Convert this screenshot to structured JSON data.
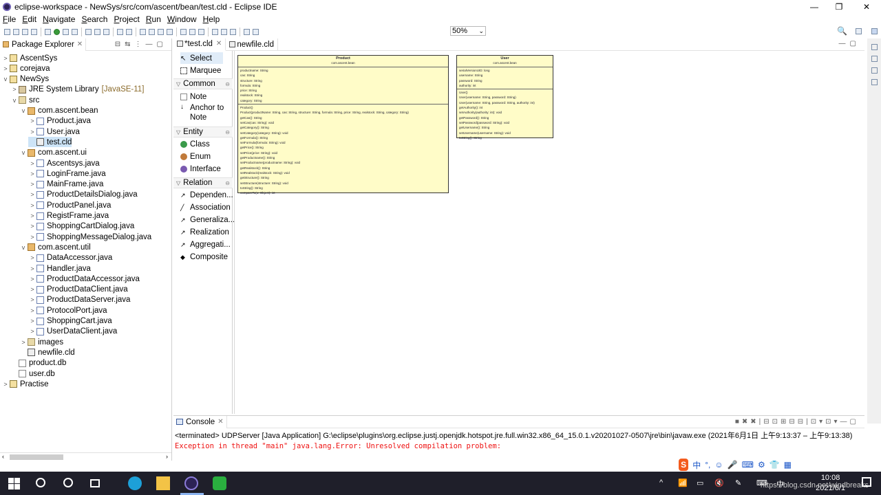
{
  "window": {
    "title": "eclipse-workspace - NewSys/src/com/ascent/bean/test.cld - Eclipse IDE",
    "minimize": "—",
    "maximize": "❐",
    "close": "✕"
  },
  "menu": [
    "File",
    "Edit",
    "Navigate",
    "Search",
    "Project",
    "Run",
    "Window",
    "Help"
  ],
  "toolbar": {
    "zoom": "50%"
  },
  "package_explorer": {
    "title": "Package Explorer",
    "tree": [
      {
        "label": "AscentSys",
        "level": 0,
        "toggle": ">",
        "icon": "project-icon"
      },
      {
        "label": "corejava",
        "level": 0,
        "toggle": ">",
        "icon": "project-icon"
      },
      {
        "label": "NewSys",
        "level": 0,
        "toggle": "v",
        "icon": "project-icon"
      },
      {
        "label": "JRE System Library",
        "extra": "[JavaSE-11]",
        "level": 1,
        "toggle": ">",
        "icon": "library-icon"
      },
      {
        "label": "src",
        "level": 1,
        "toggle": "v",
        "icon": "source-folder-icon"
      },
      {
        "label": "com.ascent.bean",
        "level": 2,
        "toggle": "v",
        "icon": "package-icon"
      },
      {
        "label": "Product.java",
        "level": 3,
        "toggle": ">",
        "icon": "java-file-icon"
      },
      {
        "label": "User.java",
        "level": 3,
        "toggle": ">",
        "icon": "java-file-icon"
      },
      {
        "label": "test.cld",
        "level": 3,
        "toggle": "",
        "icon": "cld-file-icon",
        "selected": true
      },
      {
        "label": "com.ascent.ui",
        "level": 2,
        "toggle": "v",
        "icon": "package-icon"
      },
      {
        "label": "Ascentsys.java",
        "level": 3,
        "toggle": ">",
        "icon": "java-file-icon"
      },
      {
        "label": "LoginFrame.java",
        "level": 3,
        "toggle": ">",
        "icon": "java-file-icon"
      },
      {
        "label": "MainFrame.java",
        "level": 3,
        "toggle": ">",
        "icon": "java-file-icon"
      },
      {
        "label": "ProductDetailsDialog.java",
        "level": 3,
        "toggle": ">",
        "icon": "java-file-icon"
      },
      {
        "label": "ProductPanel.java",
        "level": 3,
        "toggle": ">",
        "icon": "java-file-icon"
      },
      {
        "label": "RegistFrame.java",
        "level": 3,
        "toggle": ">",
        "icon": "java-file-icon"
      },
      {
        "label": "ShoppingCartDialog.java",
        "level": 3,
        "toggle": ">",
        "icon": "java-file-icon"
      },
      {
        "label": "ShoppingMessageDialog.java",
        "level": 3,
        "toggle": ">",
        "icon": "java-file-icon"
      },
      {
        "label": "com.ascent.util",
        "level": 2,
        "toggle": "v",
        "icon": "package-icon"
      },
      {
        "label": "DataAccessor.java",
        "level": 3,
        "toggle": ">",
        "icon": "java-file-icon"
      },
      {
        "label": "Handler.java",
        "level": 3,
        "toggle": ">",
        "icon": "java-file-icon"
      },
      {
        "label": "ProductDataAccessor.java",
        "level": 3,
        "toggle": ">",
        "icon": "java-file-icon"
      },
      {
        "label": "ProductDataClient.java",
        "level": 3,
        "toggle": ">",
        "icon": "java-file-icon"
      },
      {
        "label": "ProductDataServer.java",
        "level": 3,
        "toggle": ">",
        "icon": "java-file-icon"
      },
      {
        "label": "ProtocolPort.java",
        "level": 3,
        "toggle": ">",
        "icon": "java-file-icon"
      },
      {
        "label": "ShoppingCart.java",
        "level": 3,
        "toggle": ">",
        "icon": "java-file-icon"
      },
      {
        "label": "UserDataClient.java",
        "level": 3,
        "toggle": ">",
        "icon": "java-file-icon"
      },
      {
        "label": "images",
        "level": 2,
        "toggle": ">",
        "icon": "folder-icon"
      },
      {
        "label": "newfile.cld",
        "level": 2,
        "toggle": "",
        "icon": "cld-file-icon"
      },
      {
        "label": "product.db",
        "level": 1,
        "toggle": "",
        "icon": "file-icon"
      },
      {
        "label": "user.db",
        "level": 1,
        "toggle": "",
        "icon": "file-icon"
      },
      {
        "label": "Practise",
        "level": 0,
        "toggle": ">",
        "icon": "project-icon"
      }
    ]
  },
  "editor": {
    "tabs": [
      {
        "label": "*test.cld",
        "active": true
      },
      {
        "label": "newfile.cld",
        "active": false
      }
    ]
  },
  "palette": {
    "tools": [
      {
        "label": "Select",
        "icon": "select-arrow-icon",
        "selected": true
      },
      {
        "label": "Marquee",
        "icon": "marquee-icon"
      }
    ],
    "drawers": [
      {
        "label": "Common",
        "items": [
          {
            "label": "Note",
            "icon": "note-icon"
          },
          {
            "label": "Anchor to Note",
            "icon": "anchor-icon"
          }
        ]
      },
      {
        "label": "Entity",
        "items": [
          {
            "label": "Class",
            "icon": "class-icon"
          },
          {
            "label": "Enum",
            "icon": "enum-icon"
          },
          {
            "label": "Interface",
            "icon": "interface-icon"
          }
        ]
      },
      {
        "label": "Relation",
        "items": [
          {
            "label": "Dependen...",
            "icon": "dependency-icon"
          },
          {
            "label": "Association",
            "icon": "association-icon"
          },
          {
            "label": "Generaliza...",
            "icon": "generalization-icon"
          },
          {
            "label": "Realization",
            "icon": "realization-icon"
          },
          {
            "label": "Aggregati...",
            "icon": "aggregation-icon"
          },
          {
            "label": "Composite",
            "icon": "composite-icon"
          }
        ]
      }
    ]
  },
  "diagram": {
    "product": {
      "name": "Product",
      "package": "com.ascent.bean",
      "fields": [
        "productname: String",
        "cas: String",
        "structure: String",
        "formula: String",
        "price: String",
        "realstock: String",
        "category: String"
      ],
      "methods": [
        "Product()",
        "Product(productName: String, cas: String, structure: String, formula: String, price: String, realstock: String, category: String)",
        "getCas(): String",
        "setCas(cas: String): void",
        "getCategory(): String",
        "setCategory(category: String): void",
        "getFormula(): String",
        "setFormula(formula: String): void",
        "getPrice(): String",
        "setPrice(price: String): void",
        "getProductname(): String",
        "setProductname(productname: String): void",
        "getRealstock(): String",
        "setRealstock(realstock: String): void",
        "getStructure(): String",
        "setStructure(structure: String): void",
        "toString(): String",
        "compareTo(o: Object): int"
      ]
    },
    "user": {
      "name": "User",
      "package": "com.ascent.bean",
      "fields": [
        "serialVersionUID: long",
        "username: String",
        "password: String",
        "authority: int"
      ],
      "methods": [
        "User()",
        "User(username: String, password: String)",
        "User(username: String, password: String, authority: int)",
        "getAuthority(): int",
        "setAuthority(authority: int): void",
        "getPassword(): String",
        "setPassword(password: String): void",
        "getUsername(): String",
        "setUsername(username: String): void",
        "toString(): String"
      ]
    }
  },
  "console": {
    "title": "Console",
    "terminated": "<terminated> UDPServer [Java Application] G:\\eclipse\\plugins\\org.eclipse.justj.openjdk.hotspot.jre.full.win32.x86_64_15.0.1.v20201027-0507\\jre\\bin\\javaw.exe  (2021年6月1日 上午9:13:37 – 上午9:13:38)",
    "error": "Exception in thread \"main\" java.lang.Error: Unresolved compilation problem:"
  },
  "ime": {
    "logo": "S",
    "items": [
      "中",
      "°,",
      "☺",
      "🎤",
      "⌨",
      "⚙",
      "👕",
      "▦"
    ]
  },
  "taskbar": {
    "time": "10:08",
    "date": "2021/6/1",
    "tray": [
      "^",
      "📶",
      "▭",
      "🔇",
      "✎",
      "⌨",
      "中"
    ],
    "watermark": "https://blog.csdn.net/windbreaks"
  },
  "colors": {
    "accent": "#2b5797",
    "error": "#e11111",
    "uml_fill": "#fffcc8",
    "selection": "#cde4f7"
  }
}
